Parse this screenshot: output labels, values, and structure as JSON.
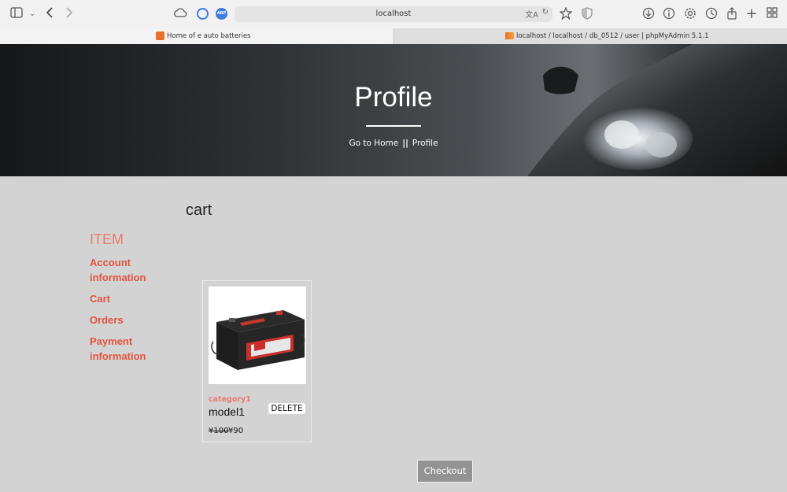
{
  "browser": {
    "url": "localhost",
    "tabs": [
      {
        "title": "Home of e auto batteries"
      },
      {
        "title": "localhost / localhost / db_0512 / user | phpMyAdmin 5.1.1"
      }
    ],
    "icons": [
      "sidebar-icon",
      "back-icon",
      "forward-icon",
      "cloud-icon",
      "extension-icon",
      "adblock-icon",
      "translate-icon",
      "reload-icon",
      "bookmark-star-icon",
      "shield-icon",
      "download-icon",
      "info-icon",
      "settings-icon",
      "history-icon",
      "share-icon",
      "new-tab-icon",
      "tab-overview-icon"
    ],
    "abp_label": "ABP"
  },
  "hero": {
    "title": "Profile",
    "breadcrumb_home": "Go to Home",
    "breadcrumb_sep": "||",
    "breadcrumb_current": "Profile"
  },
  "sidebar": {
    "title": "ITEM",
    "items": [
      {
        "label": "Account information"
      },
      {
        "label": "Cart"
      },
      {
        "label": "Orders"
      },
      {
        "label": "Payment information"
      }
    ]
  },
  "main": {
    "heading": "cart",
    "items": [
      {
        "category": "category1",
        "model": "model1",
        "delete_label": "DELETE",
        "price_old": "¥100",
        "price_new": "¥90",
        "image": "battery"
      }
    ],
    "checkout_label": "Checkout"
  },
  "colors": {
    "accent": "#e0533f",
    "sidebar_title": "#ea7a6e",
    "background": "#d3d3d3"
  }
}
